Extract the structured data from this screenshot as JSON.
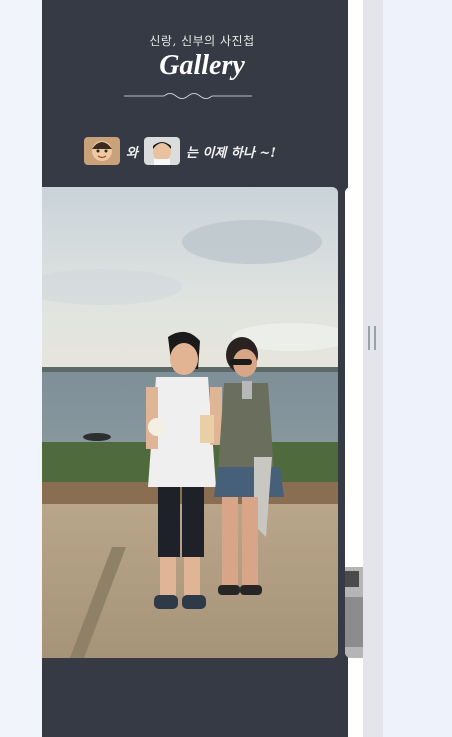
{
  "header": {
    "subtitle": "신랑, 신부의 사진첩",
    "title": "Gallery"
  },
  "caption": {
    "connector": "와",
    "message": "는 이제 하나 ~!"
  },
  "icons": {
    "divider": "ornament-divider-icon",
    "bride_avatar": "bride-avatar",
    "groom_avatar": "groom-avatar",
    "scroll_grip": "scroll-grip-icon"
  },
  "colors": {
    "panel_bg": "#353a44",
    "page_bg": "#eef2fb"
  }
}
